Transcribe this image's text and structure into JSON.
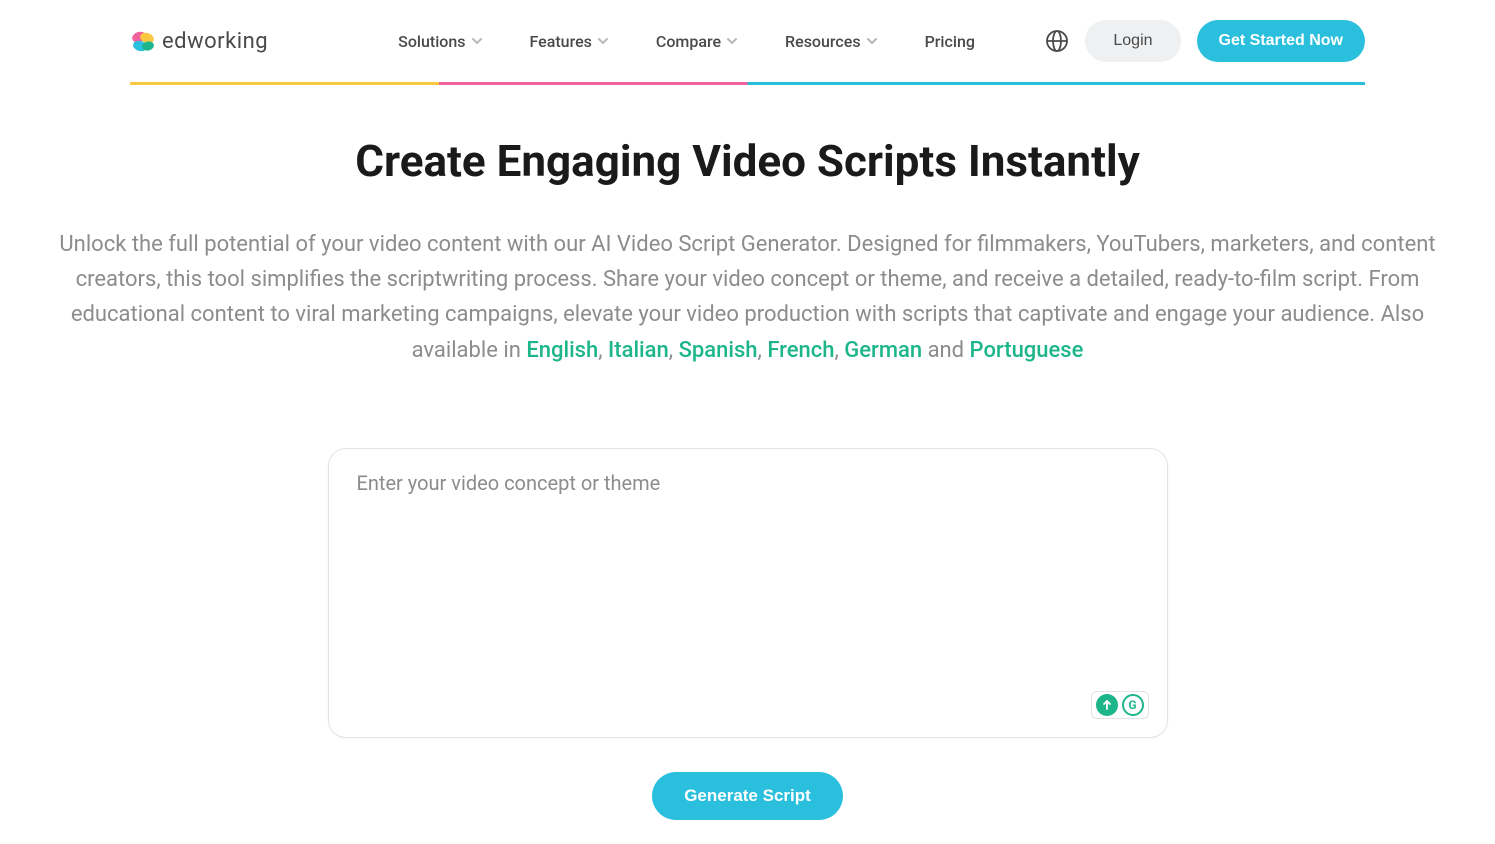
{
  "brand": {
    "name": "edworking"
  },
  "nav": {
    "items": [
      {
        "label": "Solutions"
      },
      {
        "label": "Features"
      },
      {
        "label": "Compare"
      },
      {
        "label": "Resources"
      },
      {
        "label": "Pricing"
      }
    ]
  },
  "header": {
    "login": "Login",
    "cta": "Get Started Now"
  },
  "hero": {
    "title": "Create Engaging Video Scripts Instantly",
    "desc_part1": "Unlock the full potential of your video content with our AI Video Script Generator. Designed for filmmakers, YouTubers, marketers, and content creators, this tool simplifies the scriptwriting process. Share your video concept or theme, and receive a detailed, ready-to-film script. From educational content to viral marketing campaigns, elevate your video production with scripts that captivate and engage your audience. Also available in ",
    "lang1": "English",
    "sep1": ", ",
    "lang2": "Italian",
    "sep2": ", ",
    "lang3": "Spanish",
    "sep3": ", ",
    "lang4": "French",
    "sep4": ", ",
    "lang5": "German",
    "desc_and": " and ",
    "lang6": "Portuguese"
  },
  "input": {
    "placeholder": "Enter your video concept or theme"
  },
  "action": {
    "generate": "Generate Script"
  }
}
